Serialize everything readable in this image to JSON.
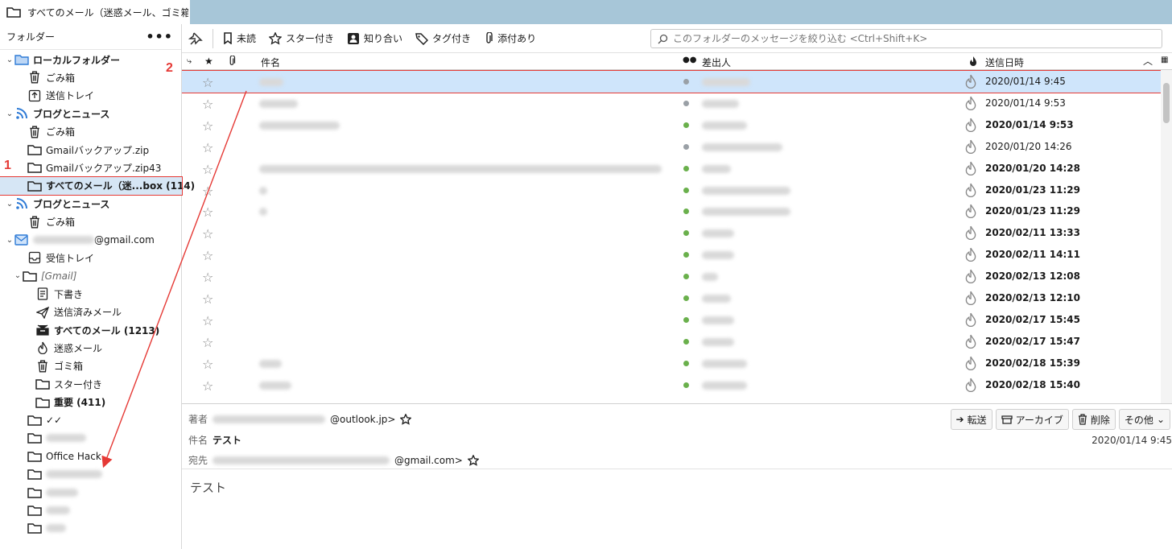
{
  "tab": {
    "title": "すべてのメール（迷惑メール、ゴミ箱("
  },
  "folders": {
    "header": "フォルダー",
    "more": "•••",
    "items": [
      {
        "label": "ローカルフォルダー",
        "icon": "local-folder-icon"
      },
      {
        "label": "ごみ箱",
        "icon": "trash-icon"
      },
      {
        "label": "送信トレイ",
        "icon": "outbox-icon"
      },
      {
        "label": "ブログとニュース",
        "icon": "rss-icon"
      },
      {
        "label": "ごみ箱",
        "icon": "trash-icon"
      },
      {
        "label": "Gmailバックアップ.zip",
        "icon": "folder-icon"
      },
      {
        "label": "Gmailバックアップ.zip43",
        "icon": "folder-icon"
      },
      {
        "label": "すべてのメール（迷...box (114)",
        "icon": "folder-icon"
      },
      {
        "label": "ブログとニュース",
        "icon": "rss-icon"
      },
      {
        "label": "ごみ箱",
        "icon": "trash-icon"
      },
      {
        "label": "@gmail.com",
        "icon": "mail-account-icon"
      },
      {
        "label": "受信トレイ",
        "icon": "inbox-icon"
      },
      {
        "label": "[Gmail]",
        "icon": "folder-icon"
      },
      {
        "label": "下書き",
        "icon": "draft-icon"
      },
      {
        "label": "送信済みメール",
        "icon": "sent-icon"
      },
      {
        "label": "すべてのメール (1213)",
        "icon": "archive-icon"
      },
      {
        "label": "迷惑メール",
        "icon": "junk-icon"
      },
      {
        "label": "ゴミ箱",
        "icon": "trash-icon"
      },
      {
        "label": "スター付き",
        "icon": "folder-icon"
      },
      {
        "label": "重要 (411)",
        "icon": "folder-icon"
      },
      {
        "label": "✓✓",
        "icon": "folder-icon"
      },
      {
        "label": "",
        "icon": "folder-icon"
      },
      {
        "label": "Office Hack",
        "icon": "folder-icon"
      },
      {
        "label": "",
        "icon": "folder-icon"
      },
      {
        "label": "",
        "icon": "folder-icon"
      },
      {
        "label": "",
        "icon": "folder-icon"
      },
      {
        "label": "",
        "icon": "folder-icon"
      }
    ]
  },
  "toolbar": {
    "unread": "未読",
    "starred": "スター付き",
    "contacts": "知り合い",
    "tagged": "タグ付き",
    "attachment": "添付あり",
    "search_placeholder": "このフォルダーのメッセージを絞り込む <Ctrl+Shift+K>"
  },
  "columns": {
    "subject": "件名",
    "sender": "差出人",
    "date": "送信日時"
  },
  "messages": [
    {
      "date": "2020/01/14 9:45",
      "unread": false,
      "dot": "#9aa0a6"
    },
    {
      "date": "2020/01/14 9:53",
      "unread": false,
      "dot": "#9aa0a6"
    },
    {
      "date": "2020/01/14 9:53",
      "unread": true,
      "dot": "#6ab04c"
    },
    {
      "date": "2020/01/20 14:26",
      "unread": false,
      "dot": "#9aa0a6"
    },
    {
      "date": "2020/01/20 14:28",
      "unread": true,
      "dot": "#6ab04c"
    },
    {
      "date": "2020/01/23 11:29",
      "unread": true,
      "dot": "#6ab04c"
    },
    {
      "date": "2020/01/23 11:29",
      "unread": true,
      "dot": "#6ab04c"
    },
    {
      "date": "2020/02/11 13:33",
      "unread": true,
      "dot": "#6ab04c"
    },
    {
      "date": "2020/02/11 14:11",
      "unread": true,
      "dot": "#6ab04c"
    },
    {
      "date": "2020/02/13 12:08",
      "unread": true,
      "dot": "#6ab04c"
    },
    {
      "date": "2020/02/13 12:10",
      "unread": true,
      "dot": "#6ab04c"
    },
    {
      "date": "2020/02/17 15:45",
      "unread": true,
      "dot": "#6ab04c"
    },
    {
      "date": "2020/02/17 15:47",
      "unread": true,
      "dot": "#6ab04c"
    },
    {
      "date": "2020/02/18 15:39",
      "unread": true,
      "dot": "#6ab04c"
    },
    {
      "date": "2020/02/18 15:40",
      "unread": true,
      "dot": "#6ab04c"
    }
  ],
  "header": {
    "from_label": "著者",
    "from_value": "@outlook.jp>",
    "subject_label": "件名",
    "subject_value": "テスト",
    "to_label": "宛先",
    "to_value": "@gmail.com>",
    "date": "2020/01/14 9:45",
    "forward": "転送",
    "archive": "アーカイブ",
    "delete": "削除",
    "other": "その他"
  },
  "body": {
    "text": "テスト"
  },
  "annotations": {
    "step1": "1",
    "step2": "2"
  },
  "colors": {
    "accent": "#e53935",
    "selection": "#cfe5fb",
    "tabbar": "#a7c6d8"
  }
}
